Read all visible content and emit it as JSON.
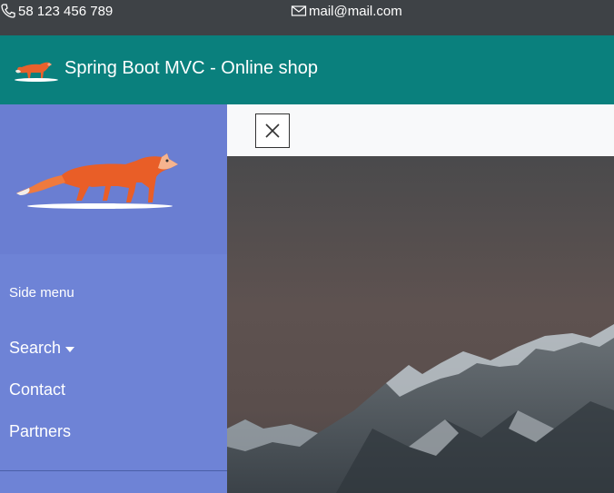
{
  "topbar": {
    "phone": "58 123 456 789",
    "email": "mail@mail.com",
    "phone_icon": "phone-icon",
    "email_icon": "envelope-icon"
  },
  "header": {
    "brand": "Spring Boot MVC - Online shop",
    "logo_icon": "fox-logo-icon",
    "background": "#0a807d"
  },
  "sidebar": {
    "title": "Side menu",
    "items": [
      {
        "label": "Search",
        "has_dropdown": true
      },
      {
        "label": "Contact"
      },
      {
        "label": "Partners"
      }
    ],
    "background": "#6e83d6"
  },
  "content": {
    "close_icon": "close-icon",
    "hero_image": "mountain-landscape"
  }
}
